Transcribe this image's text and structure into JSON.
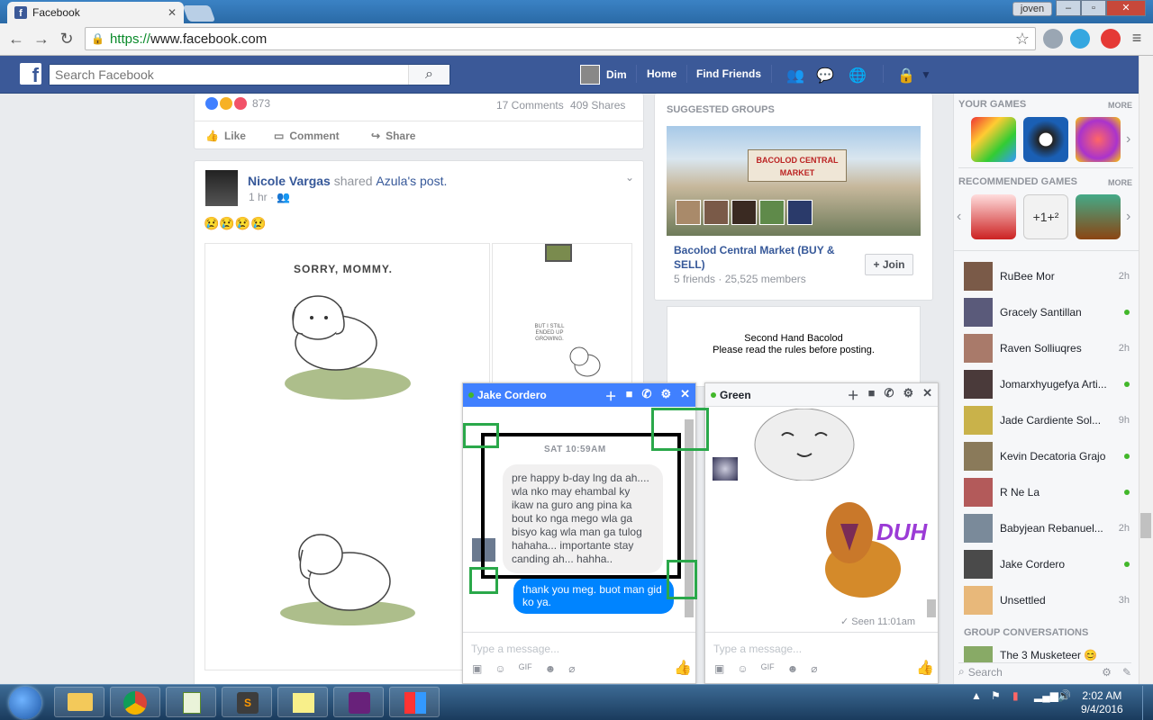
{
  "browser": {
    "tab_title": "Facebook",
    "user_button": "joven",
    "url_https": "https://",
    "url_rest": "www.facebook.com"
  },
  "fb": {
    "logo": "f",
    "search_placeholder": "Search Facebook",
    "user_name": "Dim",
    "nav_home": "Home",
    "nav_find_friends": "Find Friends"
  },
  "post_top": {
    "reaction_count": "873",
    "comments": "17 Comments",
    "shares": "409 Shares",
    "like_label": "Like",
    "comment_label": "Comment",
    "share_label": "Share"
  },
  "post": {
    "author": "Nicole Vargas",
    "shared_text": "shared",
    "origin": "Azula",
    "origin_suffix": "'s post.",
    "time": "1 hr ·",
    "emoji_text": "😢😢😢😢",
    "image_caption": "SORRY, MOMMY.",
    "image2_caption": "BUT I STILL ENDED UP GROWING."
  },
  "suggested": {
    "title": "SUGGESTED GROUPS",
    "image_sign": "BACOLOD CENTRAL MARKET",
    "group_name": "Bacolod Central Market (BUY & SELL)",
    "group_meta": "5 friends · 25,525 members",
    "join_label": "+ Join",
    "second_line1": "Second Hand Bacolod",
    "second_line2": "Please read the rules before posting."
  },
  "sidebar": {
    "your_games": "YOUR GAMES",
    "recommended_games": "RECOMMENDED GAMES",
    "more": "MORE",
    "group_conversations": "GROUP CONVERSATIONS",
    "group_conv_1": "The 3 Musketeer 😊",
    "search_placeholder": "Search",
    "contacts": [
      {
        "name": "RuBee Mor",
        "status": "2h"
      },
      {
        "name": "Gracely Santillan",
        "status": ""
      },
      {
        "name": "Raven Solliuqres",
        "status": "2h"
      },
      {
        "name": "Jomarxhyugefya Arti...",
        "status": ""
      },
      {
        "name": "Jade Cardiente Sol...",
        "status": "9h"
      },
      {
        "name": "Kevin Decatoria Grajo",
        "status": ""
      },
      {
        "name": "R Ne La",
        "status": ""
      },
      {
        "name": "Babyjean Rebanuel...",
        "status": "2h"
      },
      {
        "name": "Jake Cordero",
        "status": ""
      },
      {
        "name": "Unsettled",
        "status": "3h"
      }
    ]
  },
  "chat1": {
    "name": "Jake Cordero",
    "timestamp": "SAT 10:59AM",
    "incoming": "pre happy b-day lng da ah.... wla nko may ehambal ky ikaw na guro ang pina ka bout ko nga mego wla ga bisyo kag wla man ga tulog hahaha... importante stay canding ah... hahha..",
    "outgoing": "thank you meg. buot man gid ko ya.",
    "placeholder": "Type a message..."
  },
  "chat2": {
    "name": "Green",
    "sticker_text": "DUH",
    "seen": "✓ Seen 11:01am",
    "placeholder": "Type a message..."
  },
  "taskbar": {
    "time": "2:02 AM",
    "date": "9/4/2016"
  },
  "colors": {
    "fb_blue": "#3b5998",
    "messenger_blue": "#0084ff",
    "online_green": "#42b72a",
    "annotation_green": "#2aa84a"
  }
}
